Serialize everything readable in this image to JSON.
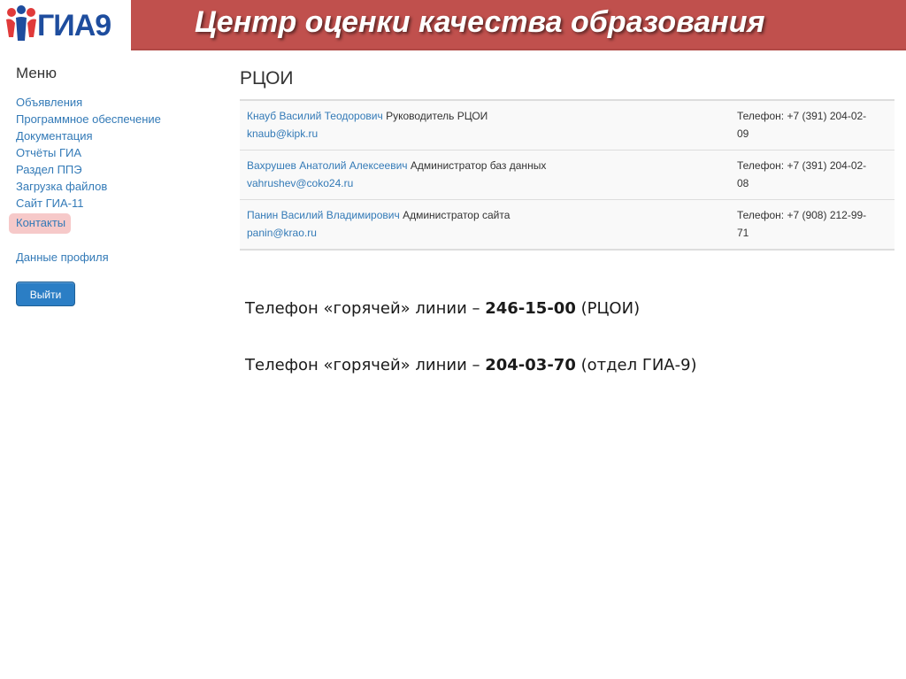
{
  "header": {
    "logo_text": "ГИА9",
    "title": "Центр оценки качества образования",
    "title_bar_color": "#c0504d"
  },
  "sidebar": {
    "menu_title": "Меню",
    "items": [
      {
        "label": "Объявления",
        "active": false
      },
      {
        "label": "Программное обеспечение",
        "active": false
      },
      {
        "label": "Документация",
        "active": false
      },
      {
        "label": "Отчёты ГИА",
        "active": false
      },
      {
        "label": "Раздел ППЭ",
        "active": false
      },
      {
        "label": "Загрузка файлов",
        "active": false
      },
      {
        "label": "Сайт ГИА-11",
        "active": false
      },
      {
        "label": "Контакты",
        "active": true
      }
    ],
    "profile_label": "Данные профиля",
    "logout_label": "Выйти"
  },
  "main": {
    "section_title": "РЦОИ",
    "contacts": [
      {
        "name": "Кнауб Василий Теодорович",
        "role": "Руководитель РЦОИ",
        "email": "knaub@kipk.ru",
        "phone_line1": "Телефон: +7 (391) 204-02-",
        "phone_line2": "09"
      },
      {
        "name": "Вахрушев Анатолий Алексеевич",
        "role": "Администратор баз данных",
        "email": "vahrushev@coko24.ru",
        "phone_line1": "Телефон: +7 (391) 204-02-",
        "phone_line2": "08"
      },
      {
        "name": "Панин Василий Владимирович",
        "role": "Администратор сайта",
        "email": "panin@krao.ru",
        "phone_line1": "Телефон: +7 (908) 212-99-",
        "phone_line2": "71"
      }
    ]
  },
  "hotlines": [
    {
      "prefix": "Телефон «горячей» линии – ",
      "number": "246-15-00",
      "suffix": " (РЦОИ)"
    },
    {
      "prefix": "Телефон «горячей» линии – ",
      "number": "204-03-70",
      "suffix": " (отдел ГИА-9)"
    }
  ]
}
